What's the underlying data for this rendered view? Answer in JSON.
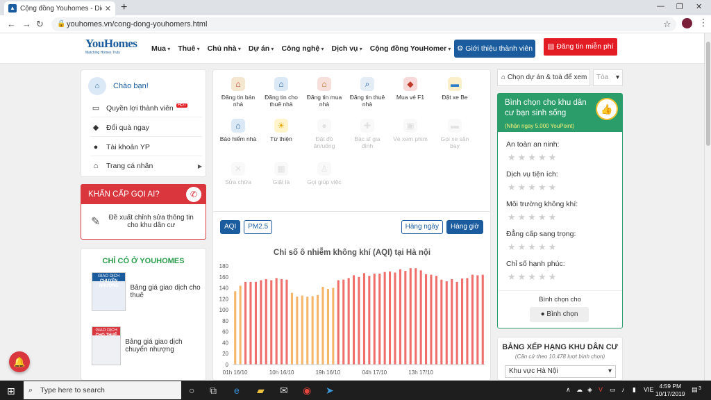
{
  "browser": {
    "tab_title": "Cộng đồng Youhomes - Diễn đàn",
    "url": "youhomes.vn/cong-dong-youhomers.html"
  },
  "site": {
    "logo_main": "YouHomes",
    "logo_tagline": "Matching Homes Truly",
    "nav": [
      "Mua",
      "Thuê",
      "Chủ nhà",
      "Dự án",
      "Công nghệ",
      "Dịch vụ",
      "Cộng đồng YouHomer"
    ],
    "intro_button": "Giới thiệu thành viên",
    "post_button": "Đăng tin miễn phí"
  },
  "sidebar": {
    "greeting": "Chào bạn!",
    "items": [
      {
        "label": "Quyền lợi thành viên",
        "icon": "card-icon",
        "hot": "HOT"
      },
      {
        "label": "Đổi quà ngay",
        "icon": "diamond-icon"
      },
      {
        "label": "Tài khoản YP",
        "icon": "user-icon"
      },
      {
        "label": "Trang cá nhân",
        "icon": "home-icon"
      }
    ],
    "urgent_title": "KHẨN CẤP GỌI AI?",
    "urgent_text": "Đề xuất chỉnh sửa thông tin cho khu dân cư",
    "only_title": "CHỈ CÓ Ở YOUHOMES",
    "only_items": [
      {
        "thumb_top": "GIAO DỊCH",
        "thumb_title": "CHUYỂN NHƯỢNG",
        "label": "Bảng giá giao dịch cho thuê"
      },
      {
        "thumb_top": "GIAO DỊCH",
        "thumb_title": "CHO THUÊ",
        "label": "Bảng giá giao dịch chuyển nhượng"
      }
    ]
  },
  "services": [
    {
      "label": "Đăng tin bán nhà",
      "icon": "house-sale-icon",
      "color": "#f5e6d0"
    },
    {
      "label": "Đăng tin cho thuê nhà",
      "icon": "house-rent-icon",
      "color": "#dbe9f7"
    },
    {
      "label": "Đăng tin mua nhà",
      "icon": "house-buy-icon",
      "color": "#f7e0dc"
    },
    {
      "label": "Đăng tin thuê nhà",
      "icon": "search-house-icon",
      "color": "#e4ecf5"
    },
    {
      "label": "Mua vé F1",
      "icon": "ticket-icon",
      "color": "#f7d9d9"
    },
    {
      "label": "Đặt xe Be",
      "icon": "car-icon",
      "color": "#fbefc9"
    },
    {
      "label": "Bảo hiểm nhà",
      "icon": "shield-house-icon",
      "color": "#dbe9f7"
    },
    {
      "label": "Từ thiện",
      "icon": "charity-icon",
      "color": "#fff4cc"
    },
    {
      "label": "Đặt đồ ăn/uống",
      "icon": "food-icon",
      "color": "#eee"
    },
    {
      "label": "Bác sĩ gia đình",
      "icon": "doctor-icon",
      "color": "#eee"
    },
    {
      "label": "Vé xem phim",
      "icon": "movie-icon",
      "color": "#eee"
    },
    {
      "label": "Gọi xe sân bay",
      "icon": "airport-car-icon",
      "color": "#eee"
    },
    {
      "label": "Sửa chữa",
      "icon": "repair-icon",
      "color": "#eee"
    },
    {
      "label": "Giặt là",
      "icon": "laundry-icon",
      "color": "#eee"
    },
    {
      "label": "Gọi giúp việc",
      "icon": "helper-icon",
      "color": "#eee"
    }
  ],
  "aqi": {
    "tab_aqi": "AQI",
    "tab_pm": "PM2.5",
    "tab_day": "Hàng ngày",
    "tab_hour": "Hàng giờ"
  },
  "chart_data": {
    "type": "bar",
    "title": "Chỉ số ô nhiễm không khí (AQI) tại Hà nội",
    "ylim": [
      0,
      180
    ],
    "yticks": [
      0,
      20,
      40,
      60,
      80,
      100,
      120,
      140,
      160,
      180
    ],
    "xtick_labels": [
      "01h 16/10",
      "10h 16/10",
      "19h 16/10",
      "04h 17/10",
      "13h 17/10"
    ],
    "values": [
      134,
      144,
      151,
      151,
      151,
      154,
      156,
      154,
      158,
      156,
      155,
      131,
      124,
      126,
      124,
      125,
      127,
      142,
      138,
      140,
      154,
      155,
      158,
      163,
      160,
      167,
      162,
      166,
      166,
      169,
      170,
      168,
      174,
      171,
      176,
      176,
      172,
      165,
      164,
      162,
      155,
      152,
      156,
      151,
      157,
      158,
      164,
      163,
      164
    ],
    "colors": {
      "unhealthy": "#ef6f6c",
      "sensitive": "#f5b56b"
    },
    "sensitive_range": [
      100,
      150
    ]
  },
  "right": {
    "select_project": "Chọn dự án & toà để xem",
    "select_tower": "Tòa",
    "vote_title": "Bình chọn cho khu dân cư bạn sinh sống",
    "vote_sub": "(Nhận ngay 5.000 YouPoint)",
    "criteria": [
      "An toàn an ninh:",
      "Dịch vụ tiện ích:",
      "Môi trường không khí:",
      "Đẳng cấp sang trọng:",
      "Chỉ số hạnh phúc:"
    ],
    "vote_for": "Bình chọn cho",
    "vote_button": "Bình chọn",
    "rank_title": "BẢNG XẾP HẠNG KHU DÂN CƯ",
    "rank_sub": "(Căn cứ theo 10.478 lượt bình chọn)",
    "rank_select": "Khu vực Hà Nội"
  },
  "taskbar": {
    "search_placeholder": "Type here to search",
    "lang": "VIE",
    "time": "4:59 PM",
    "date": "10/17/2019",
    "notif_count": "3"
  }
}
